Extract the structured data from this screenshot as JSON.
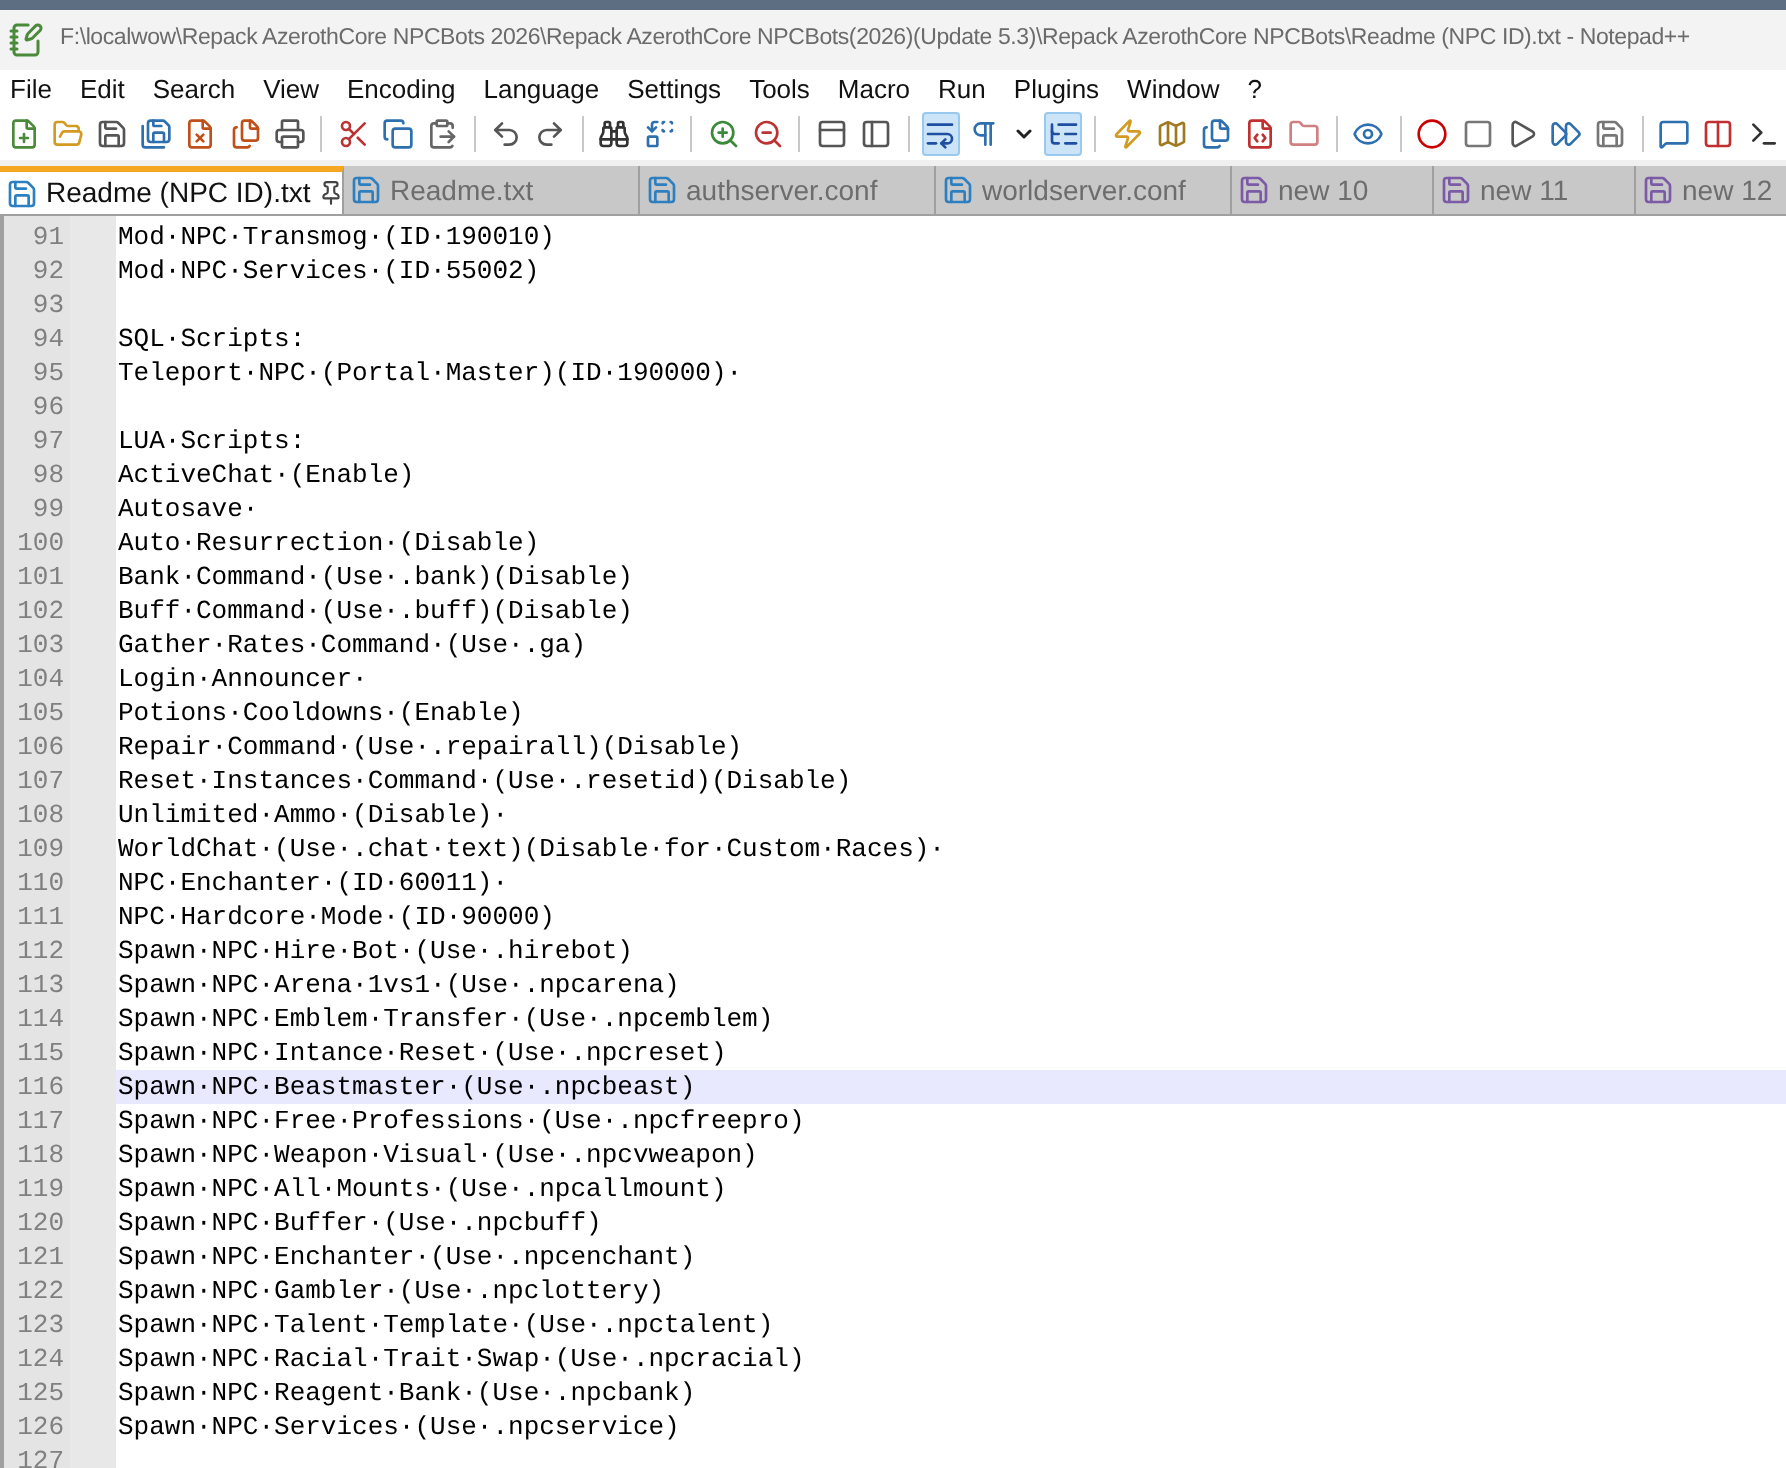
{
  "window": {
    "title": "F:\\localwow\\Repack AzerothCore NPCBots 2026\\Repack AzerothCore NPCBots(2026)(Update 5.3)\\Repack AzerothCore NPCBots\\Readme (NPC ID).txt - Notepad++"
  },
  "menu": [
    "File",
    "Edit",
    "Search",
    "View",
    "Encoding",
    "Language",
    "Settings",
    "Tools",
    "Macro",
    "Run",
    "Plugins",
    "Window",
    "?"
  ],
  "toolbar": [
    {
      "kind": "button",
      "toggled": false
    },
    {
      "kind": "button",
      "toggled": false
    },
    {
      "kind": "button",
      "toggled": false
    },
    {
      "kind": "button",
      "toggled": false
    },
    {
      "kind": "button",
      "toggled": false
    },
    {
      "kind": "button",
      "toggled": false
    },
    {
      "kind": "button",
      "toggled": false
    },
    {
      "kind": "separator"
    },
    {
      "kind": "button",
      "toggled": false
    },
    {
      "kind": "button",
      "toggled": false
    },
    {
      "kind": "button",
      "toggled": false
    },
    {
      "kind": "separator"
    },
    {
      "kind": "button",
      "toggled": false
    },
    {
      "kind": "button",
      "toggled": false
    },
    {
      "kind": "separator"
    },
    {
      "kind": "button",
      "toggled": false
    },
    {
      "kind": "button",
      "toggled": false
    },
    {
      "kind": "separator"
    },
    {
      "kind": "button",
      "toggled": false
    },
    {
      "kind": "button",
      "toggled": false
    },
    {
      "kind": "separator"
    },
    {
      "kind": "button",
      "toggled": false
    },
    {
      "kind": "button",
      "toggled": false
    },
    {
      "kind": "separator"
    },
    {
      "kind": "button",
      "toggled": true
    },
    {
      "kind": "button",
      "toggled": false
    },
    {
      "kind": "dropdown",
      "toggled": false
    },
    {
      "kind": "button",
      "toggled": true
    },
    {
      "kind": "separator"
    },
    {
      "kind": "button",
      "toggled": false
    },
    {
      "kind": "button",
      "toggled": false
    },
    {
      "kind": "button",
      "toggled": false
    },
    {
      "kind": "button",
      "toggled": false
    },
    {
      "kind": "button",
      "toggled": false
    },
    {
      "kind": "separator"
    },
    {
      "kind": "button",
      "toggled": false
    },
    {
      "kind": "separator"
    },
    {
      "kind": "button",
      "toggled": false
    },
    {
      "kind": "button",
      "toggled": false
    },
    {
      "kind": "button",
      "toggled": false
    },
    {
      "kind": "button",
      "toggled": false
    },
    {
      "kind": "button",
      "toggled": false
    },
    {
      "kind": "separator"
    },
    {
      "kind": "button",
      "toggled": false
    },
    {
      "kind": "button",
      "toggled": false
    },
    {
      "kind": "button",
      "toggled": false
    }
  ],
  "tabs": [
    {
      "label": "Readme (NPC ID).txt",
      "selected": true,
      "new_file": false
    },
    {
      "label": "Readme.txt",
      "selected": false,
      "new_file": false
    },
    {
      "label": "authserver.conf",
      "selected": false,
      "new_file": false
    },
    {
      "label": "worldserver.conf",
      "selected": false,
      "new_file": false
    },
    {
      "label": "new 10",
      "selected": false,
      "new_file": true
    },
    {
      "label": "new 11",
      "selected": false,
      "new_file": true
    },
    {
      "label": "new 12",
      "selected": false,
      "new_file": true
    }
  ],
  "editor": {
    "lines": [
      {
        "number": "91",
        "text": "Mod·NPC·Transmog·(ID·190010)",
        "current": false
      },
      {
        "number": "92",
        "text": "Mod·NPC·Services·(ID·55002)",
        "current": false
      },
      {
        "number": "93",
        "current": false
      },
      {
        "number": "94",
        "text": "SQL·Scripts:",
        "current": false
      },
      {
        "number": "95",
        "text": "Teleport·NPC·(Portal·Master)(ID·190000)·",
        "current": false
      },
      {
        "number": "96",
        "current": false
      },
      {
        "number": "97",
        "text": "LUA·Scripts:",
        "current": false
      },
      {
        "number": "98",
        "text": "ActiveChat·(Enable)",
        "current": false
      },
      {
        "number": "99",
        "text": "Autosave·",
        "current": false
      },
      {
        "number": "100",
        "text": "Auto·Resurrection·(Disable)",
        "current": false
      },
      {
        "number": "101",
        "text": "Bank·Command·(Use·.bank)(Disable)",
        "current": false
      },
      {
        "number": "102",
        "text": "Buff·Command·(Use·.buff)(Disable)",
        "current": false
      },
      {
        "number": "103",
        "text": "Gather·Rates·Command·(Use·.ga)",
        "current": false
      },
      {
        "number": "104",
        "text": "Login·Announcer·",
        "current": false
      },
      {
        "number": "105",
        "text": "Potions·Cooldowns·(Enable)",
        "current": false
      },
      {
        "number": "106",
        "text": "Repair·Command·(Use·.repairall)(Disable)",
        "current": false
      },
      {
        "number": "107",
        "text": "Reset·Instances·Command·(Use·.resetid)(Disable)",
        "current": false
      },
      {
        "number": "108",
        "text": "Unlimited·Ammo·(Disable)·",
        "current": false
      },
      {
        "number": "109",
        "text": "WorldChat·(Use·.chat·text)(Disable·for·Custom·Races)·",
        "current": false
      },
      {
        "number": "110",
        "text": "NPC·Enchanter·(ID·60011)·",
        "current": false
      },
      {
        "number": "111",
        "text": "NPC·Hardcore·Mode·(ID·90000)",
        "current": false
      },
      {
        "number": "112",
        "text": "Spawn·NPC·Hire·Bot·(Use·.hirebot)",
        "current": false
      },
      {
        "number": "113",
        "text": "Spawn·NPC·Arena·1vs1·(Use·.npcarena)",
        "current": false
      },
      {
        "number": "114",
        "text": "Spawn·NPC·Emblem·Transfer·(Use·.npcemblem)",
        "current": false
      },
      {
        "number": "115",
        "text": "Spawn·NPC·Intance·Reset·(Use·.npcreset)",
        "current": false
      },
      {
        "number": "116",
        "text": "Spawn·NPC·Beastmaster·(Use·.npcbeast)",
        "current": true
      },
      {
        "number": "117",
        "text": "Spawn·NPC·Free·Professions·(Use·.npcfreepro)",
        "current": false
      },
      {
        "number": "118",
        "text": "Spawn·NPC·Weapon·Visual·(Use·.npcvweapon)",
        "current": false
      },
      {
        "number": "119",
        "text": "Spawn·NPC·All·Mounts·(Use·.npcallmount)",
        "current": false
      },
      {
        "number": "120",
        "text": "Spawn·NPC·Buffer·(Use·.npcbuff)",
        "current": false
      },
      {
        "number": "121",
        "text": "Spawn·NPC·Enchanter·(Use·.npcenchant)",
        "current": false
      },
      {
        "number": "122",
        "text": "Spawn·NPC·Gambler·(Use·.npclottery)",
        "current": false
      },
      {
        "number": "123",
        "text": "Spawn·NPC·Talent·Template·(Use·.npctalent)",
        "current": false
      },
      {
        "number": "124",
        "text": "Spawn·NPC·Racial·Trait·Swap·(Use·.npcracial)",
        "current": false
      },
      {
        "number": "125",
        "text": "Spawn·NPC·Reagent·Bank·(Use·.npcbank)",
        "current": false
      },
      {
        "number": "126",
        "text": "Spawn·NPC·Services·(Use·.npcservice)",
        "current": false
      },
      {
        "number": "127",
        "current": false
      }
    ]
  }
}
